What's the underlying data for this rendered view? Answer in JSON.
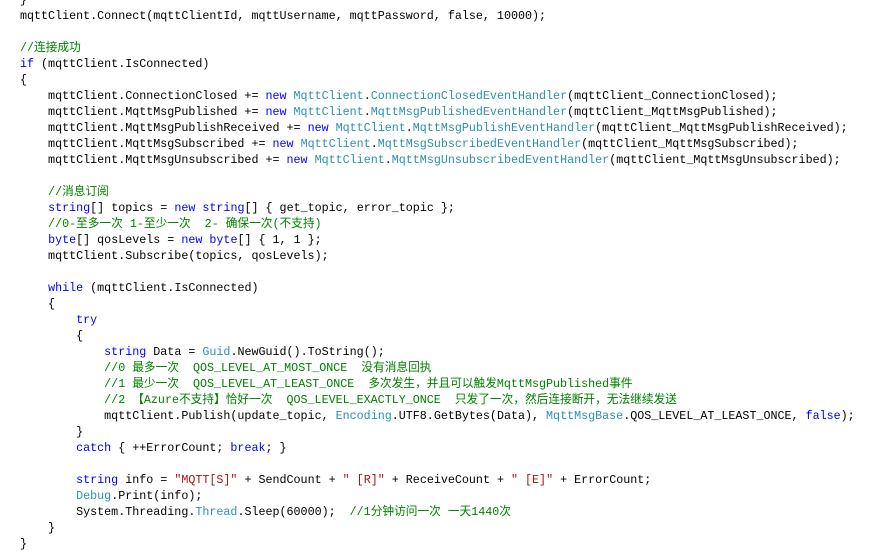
{
  "editor": {
    "colors": {
      "keyword": "#0000ff",
      "type": "#2b91af",
      "comment": "#008000",
      "string": "#a31515",
      "text": "#000000"
    },
    "lines": [
      [
        [
          "plain",
          "}"
        ]
      ],
      [
        [
          "plain",
          "mqttClient.Connect(mqttClientId, mqttUsername, mqttPassword, false, 10000);"
        ]
      ],
      [],
      [
        [
          "cm",
          "//连接成功"
        ]
      ],
      [
        [
          "kw",
          "if"
        ],
        [
          "plain",
          " (mqttClient.IsConnected)"
        ]
      ],
      [
        [
          "plain",
          "{"
        ]
      ],
      [
        [
          "plain",
          "    mqttClient.ConnectionClosed += "
        ],
        [
          "kw",
          "new"
        ],
        [
          "plain",
          " "
        ],
        [
          "type",
          "MqttClient"
        ],
        [
          "plain",
          "."
        ],
        [
          "type",
          "ConnectionClosedEventHandler"
        ],
        [
          "plain",
          "(mqttClient_ConnectionClosed);"
        ]
      ],
      [
        [
          "plain",
          "    mqttClient.MqttMsgPublished += "
        ],
        [
          "kw",
          "new"
        ],
        [
          "plain",
          " "
        ],
        [
          "type",
          "MqttClient"
        ],
        [
          "plain",
          "."
        ],
        [
          "type",
          "MqttMsgPublishedEventHandler"
        ],
        [
          "plain",
          "(mqttClient_MqttMsgPublished);"
        ]
      ],
      [
        [
          "plain",
          "    mqttClient.MqttMsgPublishReceived += "
        ],
        [
          "kw",
          "new"
        ],
        [
          "plain",
          " "
        ],
        [
          "type",
          "MqttClient"
        ],
        [
          "plain",
          "."
        ],
        [
          "type",
          "MqttMsgPublishEventHandler"
        ],
        [
          "plain",
          "(mqttClient_MqttMsgPublishReceived);"
        ]
      ],
      [
        [
          "plain",
          "    mqttClient.MqttMsgSubscribed += "
        ],
        [
          "kw",
          "new"
        ],
        [
          "plain",
          " "
        ],
        [
          "type",
          "MqttClient"
        ],
        [
          "plain",
          "."
        ],
        [
          "type",
          "MqttMsgSubscribedEventHandler"
        ],
        [
          "plain",
          "(mqttClient_MqttMsgSubscribed);"
        ]
      ],
      [
        [
          "plain",
          "    mqttClient.MqttMsgUnsubscribed += "
        ],
        [
          "kw",
          "new"
        ],
        [
          "plain",
          " "
        ],
        [
          "type",
          "MqttClient"
        ],
        [
          "plain",
          "."
        ],
        [
          "type",
          "MqttMsgUnsubscribedEventHandler"
        ],
        [
          "plain",
          "(mqttClient_MqttMsgUnsubscribed);"
        ]
      ],
      [],
      [
        [
          "cm",
          "    //消息订阅"
        ]
      ],
      [
        [
          "plain",
          "    "
        ],
        [
          "kw",
          "string"
        ],
        [
          "plain",
          "[] topics = "
        ],
        [
          "kw",
          "new"
        ],
        [
          "plain",
          " "
        ],
        [
          "kw",
          "string"
        ],
        [
          "plain",
          "[] { get_topic, error_topic };"
        ]
      ],
      [
        [
          "cm",
          "    //0-至多一次 1-至少一次  2- 确保一次(不支持)"
        ]
      ],
      [
        [
          "plain",
          "    "
        ],
        [
          "kw",
          "byte"
        ],
        [
          "plain",
          "[] qosLevels = "
        ],
        [
          "kw",
          "new"
        ],
        [
          "plain",
          " "
        ],
        [
          "kw",
          "byte"
        ],
        [
          "plain",
          "[] { 1, 1 };"
        ]
      ],
      [
        [
          "plain",
          "    mqttClient.Subscribe(topics, qosLevels);"
        ]
      ],
      [],
      [
        [
          "plain",
          "    "
        ],
        [
          "kw",
          "while"
        ],
        [
          "plain",
          " (mqttClient.IsConnected)"
        ]
      ],
      [
        [
          "plain",
          "    {"
        ]
      ],
      [
        [
          "plain",
          "        "
        ],
        [
          "kw",
          "try"
        ]
      ],
      [
        [
          "plain",
          "        {"
        ]
      ],
      [
        [
          "plain",
          "            "
        ],
        [
          "kw",
          "string"
        ],
        [
          "plain",
          " Data = "
        ],
        [
          "type",
          "Guid"
        ],
        [
          "plain",
          ".NewGuid().ToString();"
        ]
      ],
      [
        [
          "cm",
          "            //0 最多一次  QOS_LEVEL_AT_MOST_ONCE  没有消息回执"
        ]
      ],
      [
        [
          "cm",
          "            //1 最少一次  QOS_LEVEL_AT_LEAST_ONCE  多次发生，并且可以触发MqttMsgPublished事件"
        ]
      ],
      [
        [
          "cm",
          "            //2 【Azure不支持】恰好一次  QOS_LEVEL_EXACTLY_ONCE  只发了一次，然后连接断开，无法继续发送"
        ]
      ],
      [
        [
          "plain",
          "            mqttClient.Publish(update_topic, "
        ],
        [
          "type",
          "Encoding"
        ],
        [
          "plain",
          ".UTF8.GetBytes(Data), "
        ],
        [
          "type",
          "MqttMsgBase"
        ],
        [
          "plain",
          ".QOS_LEVEL_AT_LEAST_ONCE, "
        ],
        [
          "kw",
          "false"
        ],
        [
          "plain",
          ");"
        ]
      ],
      [
        [
          "plain",
          "        }"
        ]
      ],
      [
        [
          "plain",
          "        "
        ],
        [
          "kw",
          "catch"
        ],
        [
          "plain",
          " { ++ErrorCount; "
        ],
        [
          "kw",
          "break"
        ],
        [
          "plain",
          "; }"
        ]
      ],
      [],
      [
        [
          "plain",
          "        "
        ],
        [
          "kw",
          "string"
        ],
        [
          "plain",
          " info = "
        ],
        [
          "str",
          "\"MQTT[S]\""
        ],
        [
          "plain",
          " + SendCount + "
        ],
        [
          "str",
          "\" [R]\""
        ],
        [
          "plain",
          " + ReceiveCount + "
        ],
        [
          "str",
          "\" [E]\""
        ],
        [
          "plain",
          " + ErrorCount;"
        ]
      ],
      [
        [
          "plain",
          "        "
        ],
        [
          "type",
          "Debug"
        ],
        [
          "plain",
          ".Print(info);"
        ]
      ],
      [
        [
          "plain",
          "        System.Threading."
        ],
        [
          "type",
          "Thread"
        ],
        [
          "plain",
          ".Sleep(60000);  "
        ],
        [
          "cm",
          "//1分钟访问一次 一天1440次"
        ]
      ],
      [
        [
          "plain",
          "    }"
        ]
      ],
      [
        [
          "plain",
          "}"
        ]
      ]
    ]
  }
}
